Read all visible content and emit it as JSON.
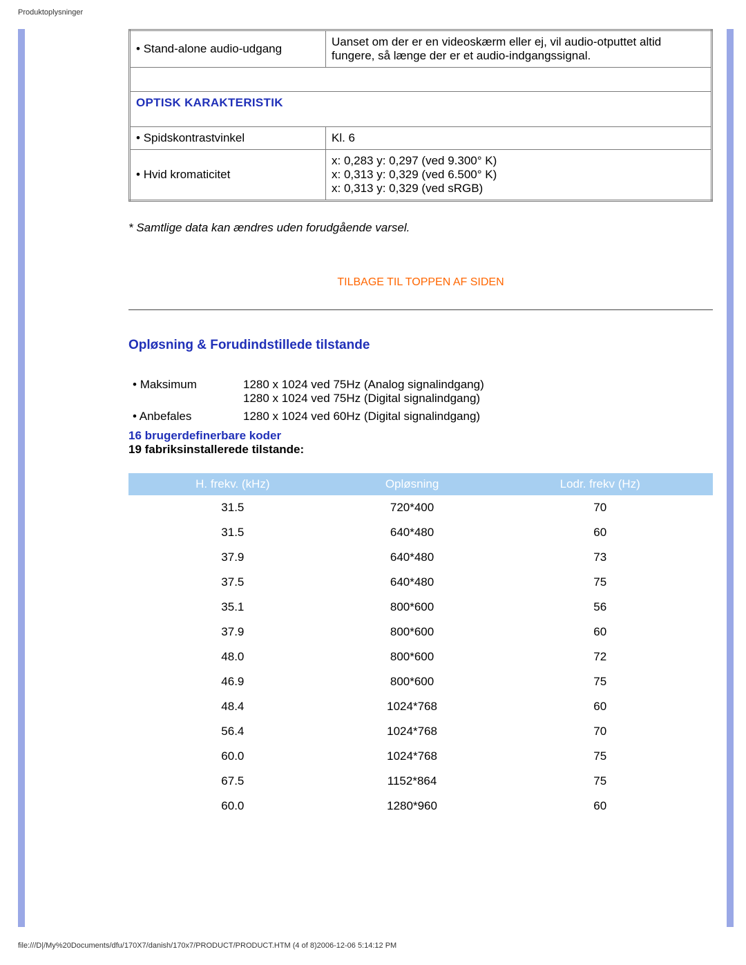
{
  "meta": {
    "header": "Produktoplysninger",
    "footer": "file:///D|/My%20Documents/dfu/170X7/danish/170x7/PRODUCT/PRODUCT.HTM (4 of 8)2006-12-06 5:14:12 PM"
  },
  "specTable": {
    "row0": {
      "label": "Stand-alone audio-udgang",
      "value": "Uanset om der er en videoskærm eller ej, vil audio-otputtet altid fungere, så længe der er et audio-indgangssignal."
    },
    "sectionTitle": "OPTISK KARAKTERISTIK",
    "row1": {
      "label": "Spidskontrastvinkel",
      "value": "Kl. 6"
    },
    "row2": {
      "label": "Hvid kromaticitet",
      "values": [
        "x: 0,283 y: 0,297 (ved 9.300° K)",
        "x: 0,313 y: 0,329 (ved 6.500° K)",
        "x: 0,313 y: 0,329 (ved sRGB)"
      ]
    }
  },
  "note": "* Samtlige data kan ændres uden forudgående varsel.",
  "topLink": "TILBAGE TIL TOPPEN AF SIDEN",
  "resolution": {
    "heading": "Opløsning & Forudindstillede tilstande",
    "items": [
      {
        "label": "Maksimum",
        "values": [
          "1280 x 1024 ved 75Hz (Analog signalindgang)",
          "1280 x 1024 ved 75Hz (Digital signalindgang)"
        ]
      },
      {
        "label": "Anbefales",
        "values": [
          "1280 x 1024 ved 60Hz (Digital signalindgang)"
        ]
      }
    ],
    "linkLine": "16 brugerdefinerbare koder",
    "boldLine": "19 fabriksinstallerede tilstande:"
  },
  "modes": {
    "headers": [
      "H. frekv. (kHz)",
      "Opløsning",
      "Lodr. frekv (Hz)"
    ],
    "rows": [
      [
        "31.5",
        "720*400",
        "70"
      ],
      [
        "31.5",
        "640*480",
        "60"
      ],
      [
        "37.9",
        "640*480",
        "73"
      ],
      [
        "37.5",
        "640*480",
        "75"
      ],
      [
        "35.1",
        "800*600",
        "56"
      ],
      [
        "37.9",
        "800*600",
        "60"
      ],
      [
        "48.0",
        "800*600",
        "72"
      ],
      [
        "46.9",
        "800*600",
        "75"
      ],
      [
        "48.4",
        "1024*768",
        "60"
      ],
      [
        "56.4",
        "1024*768",
        "70"
      ],
      [
        "60.0",
        "1024*768",
        "75"
      ],
      [
        "67.5",
        "1152*864",
        "75"
      ],
      [
        "60.0",
        "1280*960",
        "60"
      ]
    ]
  }
}
